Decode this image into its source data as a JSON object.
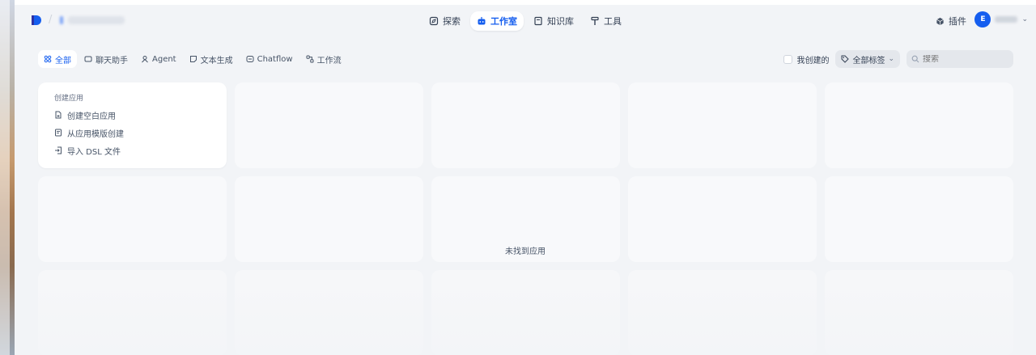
{
  "header": {
    "nav": [
      {
        "label": "探索",
        "icon": "explore-icon"
      },
      {
        "label": "工作室",
        "icon": "robot-icon"
      },
      {
        "label": "知识库",
        "icon": "book-icon"
      },
      {
        "label": "工具",
        "icon": "hammer-icon"
      }
    ],
    "plugin_label": "插件",
    "avatar_letter": "E"
  },
  "tabs": [
    {
      "label": "全部",
      "icon": "grid-icon"
    },
    {
      "label": "聊天助手",
      "icon": "chat-icon"
    },
    {
      "label": "Agent",
      "icon": "agent-icon"
    },
    {
      "label": "文本生成",
      "icon": "text-icon"
    },
    {
      "label": "Chatflow",
      "icon": "chatflow-icon"
    },
    {
      "label": "工作流",
      "icon": "workflow-icon"
    }
  ],
  "filters": {
    "mine_label": "我创建的",
    "tags_label": "全部标签",
    "search_placeholder": "搜索"
  },
  "create": {
    "title": "创建应用",
    "items": [
      {
        "label": "创建空白应用",
        "icon": "file-plus-icon"
      },
      {
        "label": "从应用模版创建",
        "icon": "template-icon"
      },
      {
        "label": "导入 DSL 文件",
        "icon": "import-icon"
      }
    ]
  },
  "empty_message": "未找到应用",
  "colors": {
    "accent": "#155eef",
    "background": "#f2f4f7"
  }
}
